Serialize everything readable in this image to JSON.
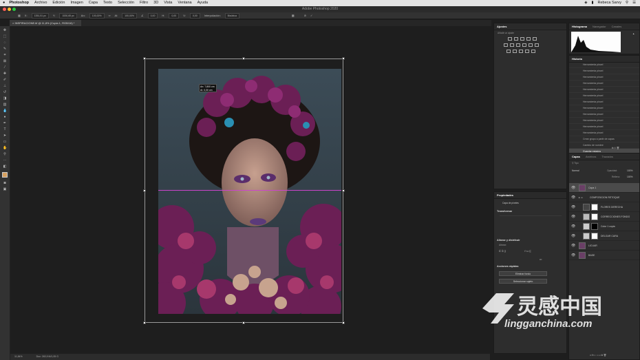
{
  "menubar": {
    "apple": "",
    "items": [
      "Photoshop",
      "Archivo",
      "Edición",
      "Imagen",
      "Capa",
      "Texto",
      "Selección",
      "Filtro",
      "3D",
      "Vista",
      "Ventana",
      "Ayuda"
    ],
    "user": "Rebeca Sarvy"
  },
  "window": {
    "title": "Adobe Photoshop 2020"
  },
  "options": {
    "x_value": "1351,51 px",
    "y_value": "1530,65 px",
    "w_value": "100,00%",
    "h_value": "100,00%",
    "angle_value": "0,00",
    "hskew_value": "0,00",
    "vskew_value": "0,00",
    "interp_label": "Interpolación:",
    "interp_value": "Bicúbica"
  },
  "document": {
    "tab_label": "INSPIRACIONE.tif @ 11,8% (Copia 1, RGB/16) *"
  },
  "measure": {
    "line1": "An: 7,800 cm",
    "line2": "Al: 0,00 cm"
  },
  "statusbar": {
    "zoom": "11,84%",
    "doc": "Doc: 263,9 M/1,05 G"
  },
  "panels": {
    "adjustments": {
      "tab": "Ajustes",
      "subtitle": "Añadir un ajuste"
    },
    "properties": {
      "tab": "Propiedades",
      "type": "Capa de píxeles",
      "transform": "Transformar",
      "align": "Alinear y distribuir",
      "align_sub": "Alinear:",
      "quick": "Acciones rápidas",
      "btn1": "Eliminar fondo",
      "btn2": "Seleccionar sujeto"
    },
    "histogram": {
      "tabs": [
        "Histograma",
        "Navegador",
        "Canales"
      ]
    },
    "history": {
      "tab": "Historia",
      "rows": [
        "Herramienta pincel",
        "Herramienta pincel",
        "Herramienta pincel",
        "Herramienta pincel",
        "Herramienta pincel",
        "Herramienta pincel",
        "Herramienta pincel",
        "Herramienta pincel",
        "Herramienta pincel",
        "Herramienta pincel",
        "Herramienta pincel",
        "Herramienta pincel",
        "Crear grupo a partir de capas",
        "Cambio de nombre",
        "Guardar estados"
      ]
    },
    "layers": {
      "tabs": [
        "Capas",
        "Archivos",
        "Trazados"
      ],
      "blend": "Normal",
      "opacity_label": "Opacidad:",
      "opacity": "100%",
      "fill_label": "Relleno:",
      "fill": "100%",
      "rows": [
        {
          "name": "Capa 1"
        },
        {
          "name": "COMPOSICION RETOQUE"
        },
        {
          "name": "FLORES DERECHA"
        },
        {
          "name": "CORRECCIONES FONDO"
        },
        {
          "name": "Color 1 copia"
        },
        {
          "name": "DELGAR CARA"
        },
        {
          "name": "LICUAR"
        },
        {
          "name": "BASE"
        }
      ]
    }
  },
  "watermark": {
    "cn": "灵感中国",
    "url": "lingganchina.com"
  }
}
